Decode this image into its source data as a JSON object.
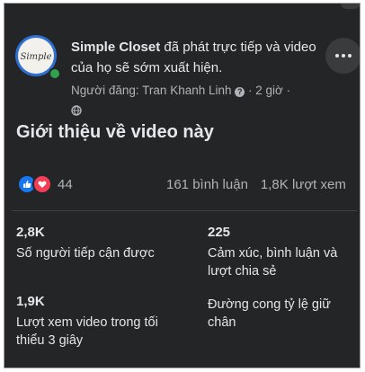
{
  "post": {
    "author": "Simple Closet",
    "text": " đã phát trực tiếp và video của họ sẽ sớm xuất hiện.",
    "posted_by": "Người đăng: Tran Khanh Linh",
    "time": "· 2 giờ ·",
    "avatar_text": "Simple"
  },
  "section": {
    "title": "Giới thiệu về video này"
  },
  "engagement": {
    "reaction_count": "44",
    "comments": "161 bình luận",
    "views": "1,8K lượt xem"
  },
  "metrics": [
    {
      "value": "2,8K",
      "label": "Số người tiếp cận được"
    },
    {
      "value": "225",
      "label": "Cảm xúc, bình luận và lượt chia sẻ"
    },
    {
      "value": "1,9K",
      "label": "Lượt xem video trong tối thiểu 3 giây"
    },
    {
      "value": "",
      "label": "Đường cong tỷ lệ giữ chân"
    }
  ],
  "icons": {
    "info": "info-icon",
    "globe": "globe-icon",
    "more": "more-options-icon",
    "like": "like-reaction-icon",
    "love": "love-reaction-icon"
  },
  "colors": {
    "background": "#242526",
    "text_primary": "#e4e6eb",
    "text_secondary": "#b0b3b8",
    "like_blue": "#1877f2",
    "love_red": "#f33e58",
    "online_green": "#31a24c"
  }
}
